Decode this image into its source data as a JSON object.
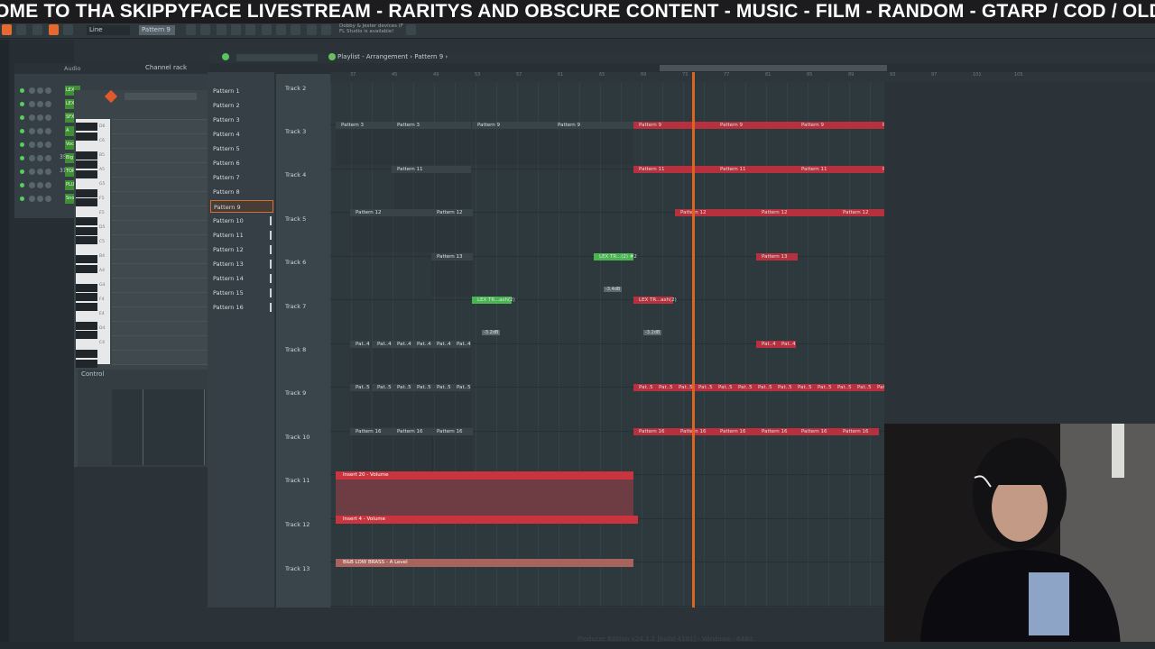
{
  "banner": {
    "text": "OME TO THA SKIPPYFACE LIVESTREAM  - RARITYS AND OBSCURE CONTENT - MUSIC - FILM - RANDOM - GTARP / COD / OLDS"
  },
  "toolbar": {
    "tool_select": "Line",
    "pattern_select": "Pattern 9",
    "news_line1": "Dobby & Jester devices (F",
    "news_line2": "FL Studio is available!"
  },
  "channel_rack": {
    "audio_label": "Audio",
    "title": "Channel rack",
    "rows": [
      {
        "num": "",
        "name": "LEX TR..."
      },
      {
        "num": "",
        "name": "LEX"
      },
      {
        "num": "",
        "name": "SFX"
      },
      {
        "num": "",
        "name": "A"
      },
      {
        "num": "",
        "name": "Voc"
      },
      {
        "num": "35",
        "name": "Big"
      },
      {
        "num": "31",
        "name": "TOR"
      },
      {
        "num": "",
        "name": "PLU"
      },
      {
        "num": "",
        "name": "Sno"
      }
    ]
  },
  "piano_roll": {
    "control_label": "Control",
    "key_labels": [
      "D6",
      "C6",
      "B5",
      "A5",
      "G5",
      "F5",
      "E5",
      "D5",
      "C5",
      "B4",
      "A4",
      "G4",
      "F4",
      "E4",
      "D4",
      "C4"
    ]
  },
  "playlist": {
    "title": "Playlist - Arrangement › Pattern 9 ›",
    "patterns": [
      {
        "label": "Pattern 1"
      },
      {
        "label": "Pattern 2"
      },
      {
        "label": "Pattern 3"
      },
      {
        "label": "Pattern 4"
      },
      {
        "label": "Pattern 5"
      },
      {
        "label": "Pattern 6"
      },
      {
        "label": "Pattern 7"
      },
      {
        "label": "Pattern 8"
      },
      {
        "label": "Pattern 9"
      },
      {
        "label": "Pattern 10"
      },
      {
        "label": "Pattern 11"
      },
      {
        "label": "Pattern 12"
      },
      {
        "label": "Pattern 13"
      },
      {
        "label": "Pattern 14"
      },
      {
        "label": "Pattern 15"
      },
      {
        "label": "Pattern 16"
      }
    ],
    "selected_pattern": "Pattern 9",
    "tracks": [
      "Track 2",
      "Track 3",
      "Track 4",
      "Track 5",
      "Track 6",
      "Track 7",
      "Track 8",
      "Track 9",
      "Track 10",
      "Track 11",
      "Track 12",
      "Track 13"
    ],
    "ruler": [
      "37",
      "45",
      "49",
      "53",
      "57",
      "61",
      "65",
      "69",
      "73",
      "77",
      "81",
      "85",
      "89",
      "93",
      "97",
      "101",
      "105"
    ],
    "clip_labels": {
      "p3": "Pattern 3",
      "p9": "Pattern 9",
      "p11": "Pattern 11",
      "p12": "Pattern 12",
      "p13": "Pattern 13",
      "lex1": "LEX TR...(2) #2",
      "lex2": "LEX TR...ash(2)",
      "lex3": "LEX TR...ash(2)",
      "pa4": "Pat..4",
      "pa5": "Pat..5",
      "p16": "Pattern 16",
      "auto1": "Insert 20 - Volume",
      "auto2": "Insert 4 - Volume",
      "auto3": "B&B LOW BRASS - A Level"
    },
    "db_labels": [
      "-3.4dB",
      "-3.2dB",
      "-3.2dB"
    ]
  },
  "status": {
    "version": "Producer Edition v24.1.2 [build 4191] - Windows - 64Bit"
  },
  "colors": {
    "accent": "#e8692e",
    "clip_red": "#b7303d",
    "clip_green": "#49b64f",
    "playhead": "#d9651f"
  }
}
